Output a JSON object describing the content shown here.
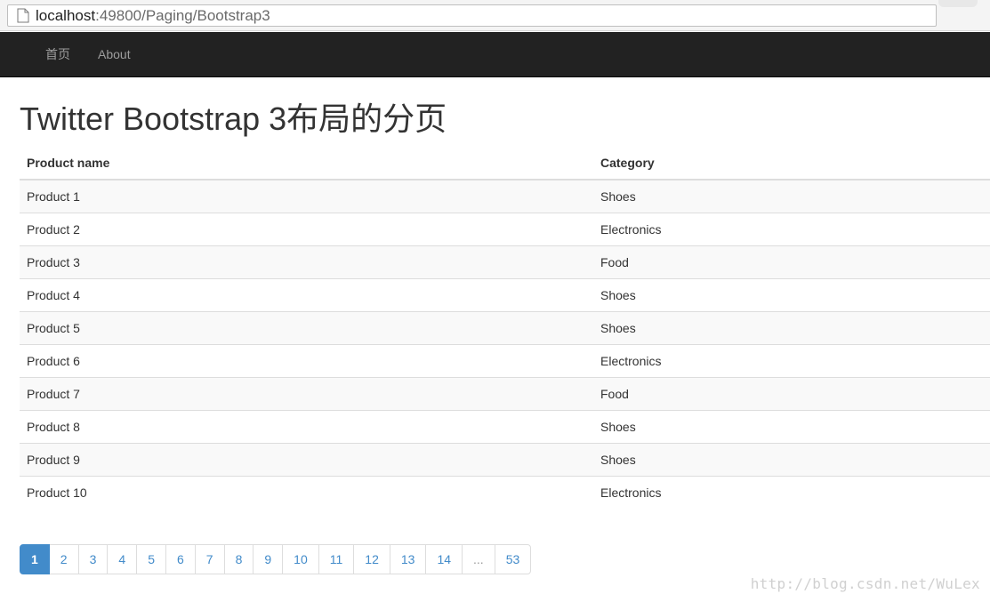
{
  "browser": {
    "url_host": "localhost",
    "url_path": ":49800/Paging/Bootstrap3"
  },
  "navbar": {
    "items": [
      {
        "label": "首页"
      },
      {
        "label": "About"
      }
    ]
  },
  "page": {
    "title": "Twitter Bootstrap 3布局的分页"
  },
  "table": {
    "columns": [
      "Product name",
      "Category"
    ],
    "rows": [
      [
        "Product 1",
        "Shoes"
      ],
      [
        "Product 2",
        "Electronics"
      ],
      [
        "Product 3",
        "Food"
      ],
      [
        "Product 4",
        "Shoes"
      ],
      [
        "Product 5",
        "Shoes"
      ],
      [
        "Product 6",
        "Electronics"
      ],
      [
        "Product 7",
        "Food"
      ],
      [
        "Product 8",
        "Shoes"
      ],
      [
        "Product 9",
        "Shoes"
      ],
      [
        "Product 10",
        "Electronics"
      ]
    ]
  },
  "pagination": {
    "pages": [
      "1",
      "2",
      "3",
      "4",
      "5",
      "6",
      "7",
      "8",
      "9",
      "10",
      "11",
      "12",
      "13",
      "14",
      "...",
      "53"
    ],
    "active_page": "1",
    "disabled": [
      "..."
    ]
  },
  "watermark": "http://blog.csdn.net/WuLex",
  "colors": {
    "navbar_bg": "#222222",
    "pagination_active": "#428bca",
    "link": "#428bca"
  }
}
